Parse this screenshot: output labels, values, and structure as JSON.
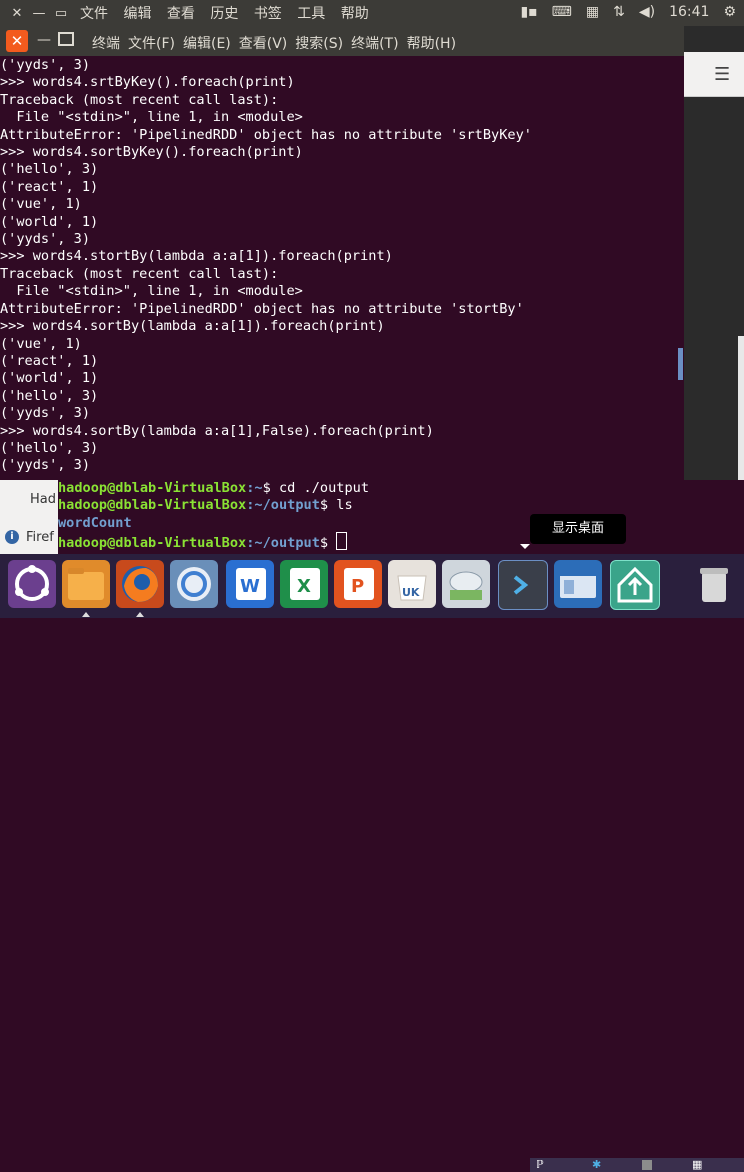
{
  "topbar": {
    "menu": [
      "文件",
      "编辑",
      "查看",
      "历史",
      "书签",
      "工具",
      "帮助"
    ],
    "clock": "16:41"
  },
  "terminal": {
    "title_menu": [
      "终端",
      "文件(F)",
      "编辑(E)",
      "查看(V)",
      "搜索(S)",
      "终端(T)",
      "帮助(H)"
    ],
    "lines": [
      "('yyds', 3)",
      ">>> words4.srtByKey().foreach(print)",
      "Traceback (most recent call last):",
      "  File \"<stdin>\", line 1, in <module>",
      "AttributeError: 'PipelinedRDD' object has no attribute 'srtByKey'",
      ">>> words4.sortByKey().foreach(print)",
      "('hello', 3)",
      "('react', 1)",
      "('vue', 1)",
      "('world', 1)",
      "('yyds', 3)",
      ">>> words4.stortBy(lambda a:a[1]).foreach(print)",
      "Traceback (most recent call last):",
      "  File \"<stdin>\", line 1, in <module>",
      "AttributeError: 'PipelinedRDD' object has no attribute 'stortBy'",
      ">>> words4.sortBy(lambda a:a[1]).foreach(print)",
      "('vue', 1)",
      "('react', 1)",
      "('world', 1)",
      "('hello', 3)",
      "('yyds', 3)",
      ">>> words4.sortBy(lambda a:a[1],False).foreach(print)",
      "('hello', 3)",
      "('yyds', 3)"
    ]
  },
  "terminal2": {
    "prompt_user": "hadoop@dblab-VirtualBox",
    "line1_path": ":~",
    "line1_cmd": "$ cd ./output",
    "line2_path": ":~/output",
    "line2_cmd": "$ ls",
    "ls_output": "wordCount",
    "line3_path": ":~/output",
    "line3_cmd": "$ "
  },
  "firefox_fragment": {
    "tab_text": "Had",
    "bar_text": "Firef"
  },
  "tooltip": "显示桌面",
  "dock_icons": [
    "ubuntu-icon",
    "files-icon",
    "firefox-icon",
    "chromium-icon",
    "word-icon",
    "excel-icon",
    "powerpoint-icon",
    "ubuntu-software-icon",
    "storage-icon",
    "terminal-icon",
    "show-desktop-icon",
    "update-icon",
    "trash-icon"
  ]
}
